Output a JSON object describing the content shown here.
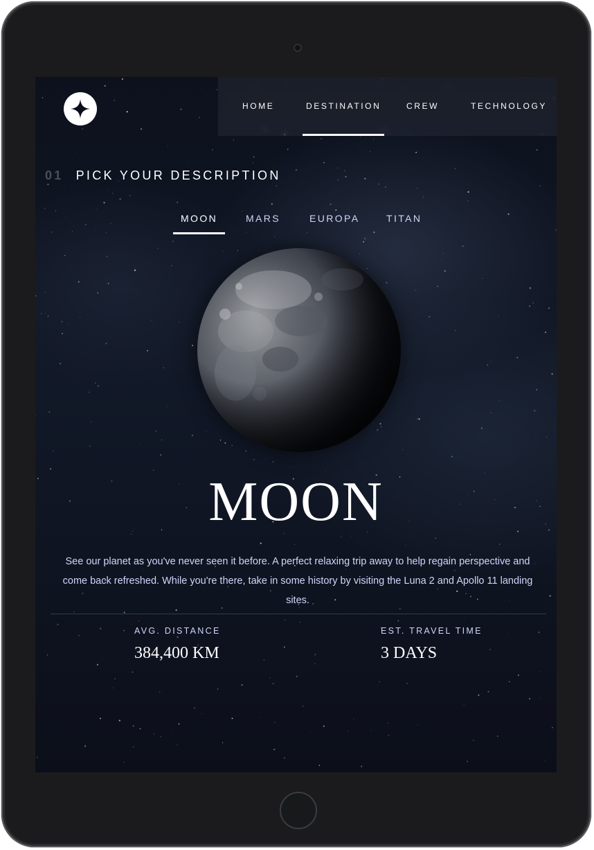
{
  "brand": {
    "logo_icon": "four-point-star-icon",
    "logo_bg": "#ffffff"
  },
  "nav": {
    "items": [
      {
        "label": "HOME"
      },
      {
        "label": "DESTINATION",
        "active": true
      },
      {
        "label": "CREW"
      },
      {
        "label": "TECHNOLOGY"
      }
    ]
  },
  "heading": {
    "number": "01",
    "title": "PICK YOUR DESCRIPTION"
  },
  "tabs": [
    {
      "label": "MOON",
      "active": true
    },
    {
      "label": "MARS"
    },
    {
      "label": "EUROPA"
    },
    {
      "label": "TITAN"
    }
  ],
  "destination": {
    "name": "MOON",
    "description": "See our planet as you've never seen it before. A perfect relaxing trip away to help regain perspective and come back refreshed. While you're there, take in some history by visiting the Luna 2 and Apollo 11 landing sites.",
    "stats": [
      {
        "label": "AVG. DISTANCE",
        "value": "384,400 KM"
      },
      {
        "label": "EST. TRAVEL TIME",
        "value": "3 DAYS"
      }
    ]
  },
  "colors": {
    "background": "#0b0d17",
    "text_muted": "#d0d6f9",
    "accent": "#ffffff"
  }
}
